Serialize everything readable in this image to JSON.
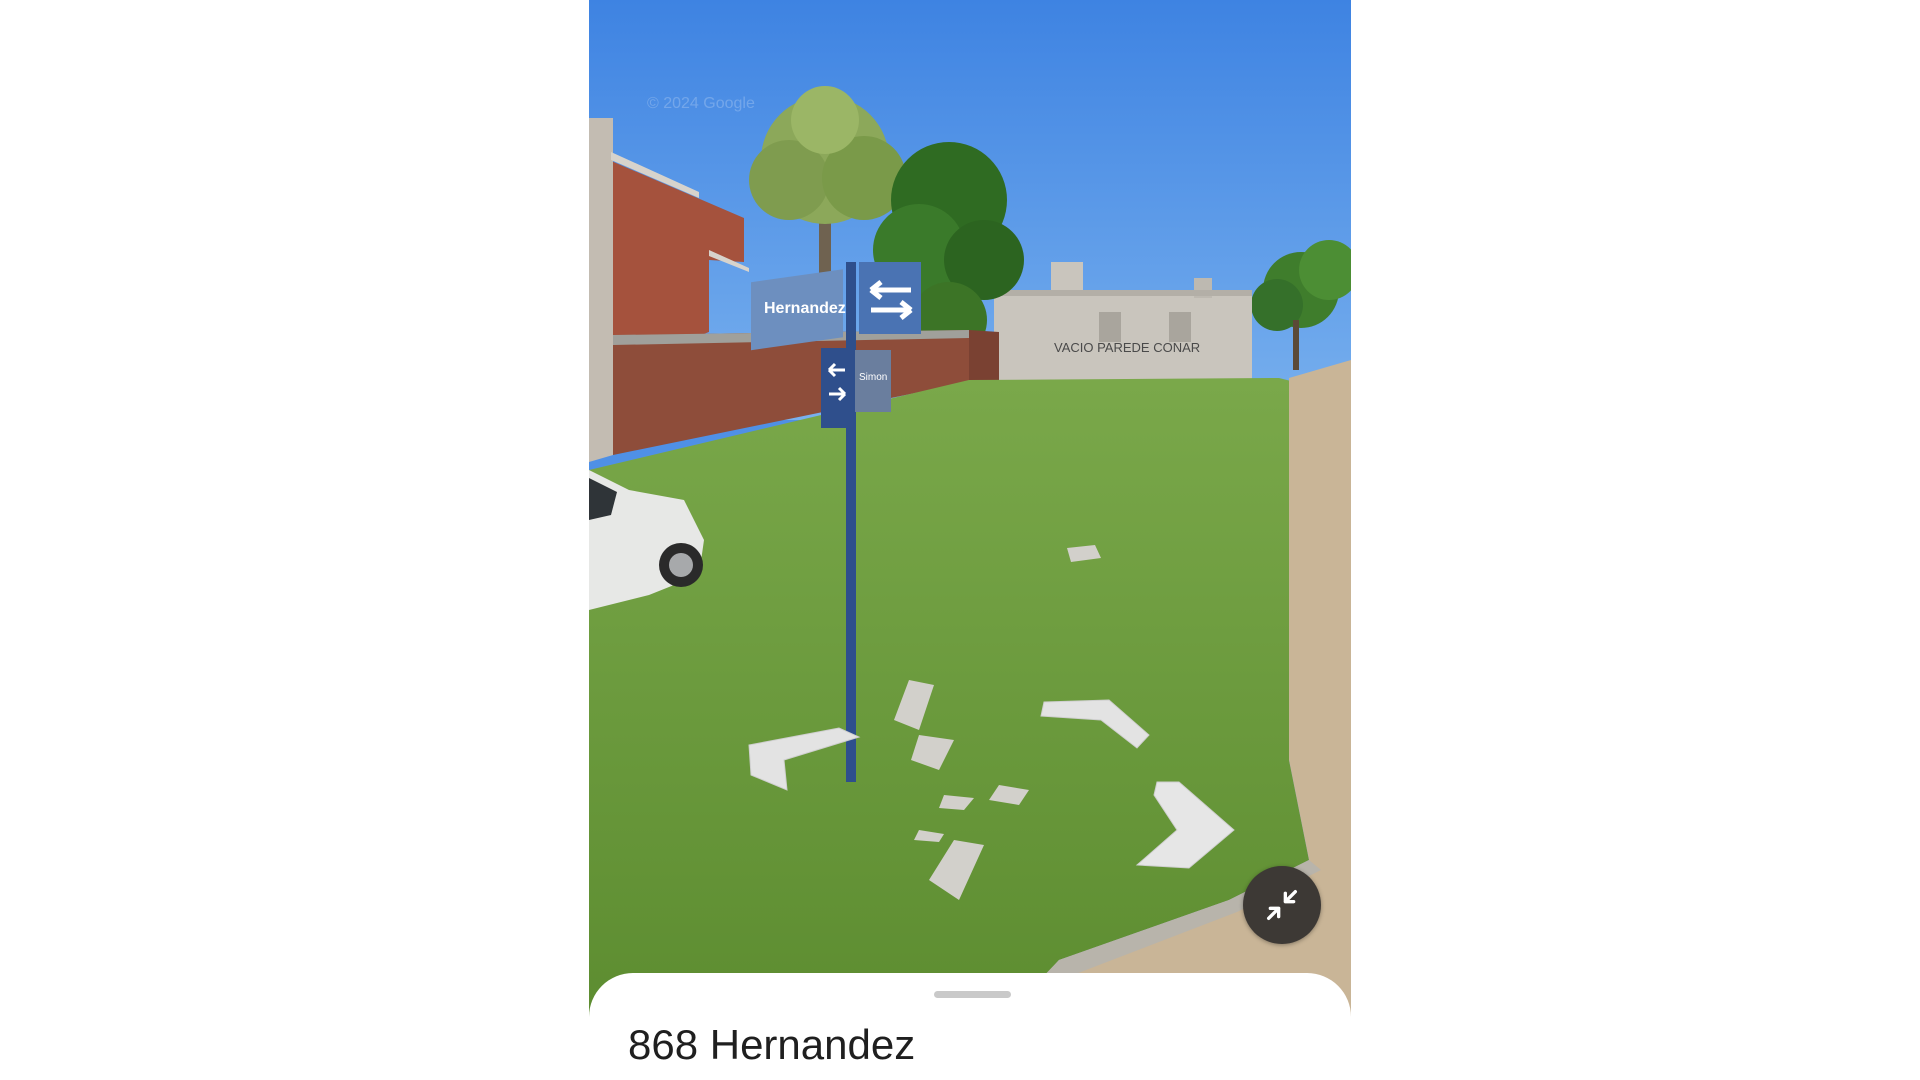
{
  "street_view": {
    "sign_primary": "Hernandez",
    "sign_secondary": "Simon",
    "watermark": "© 2024 Google",
    "wall_graffiti": "VACIO PAREDE CONAR",
    "nav_arrows": [
      "move-left",
      "move-forward",
      "move-right"
    ],
    "exit_icon": "minimize-icon"
  },
  "bottom_sheet": {
    "address": "868 Hernandez"
  },
  "colors": {
    "sky": "#4f90e6",
    "grass": "#6b9a3c",
    "sign_blue": "#6d8fbf",
    "exit_button": "#3d3935",
    "sheet": "#ffffff"
  }
}
